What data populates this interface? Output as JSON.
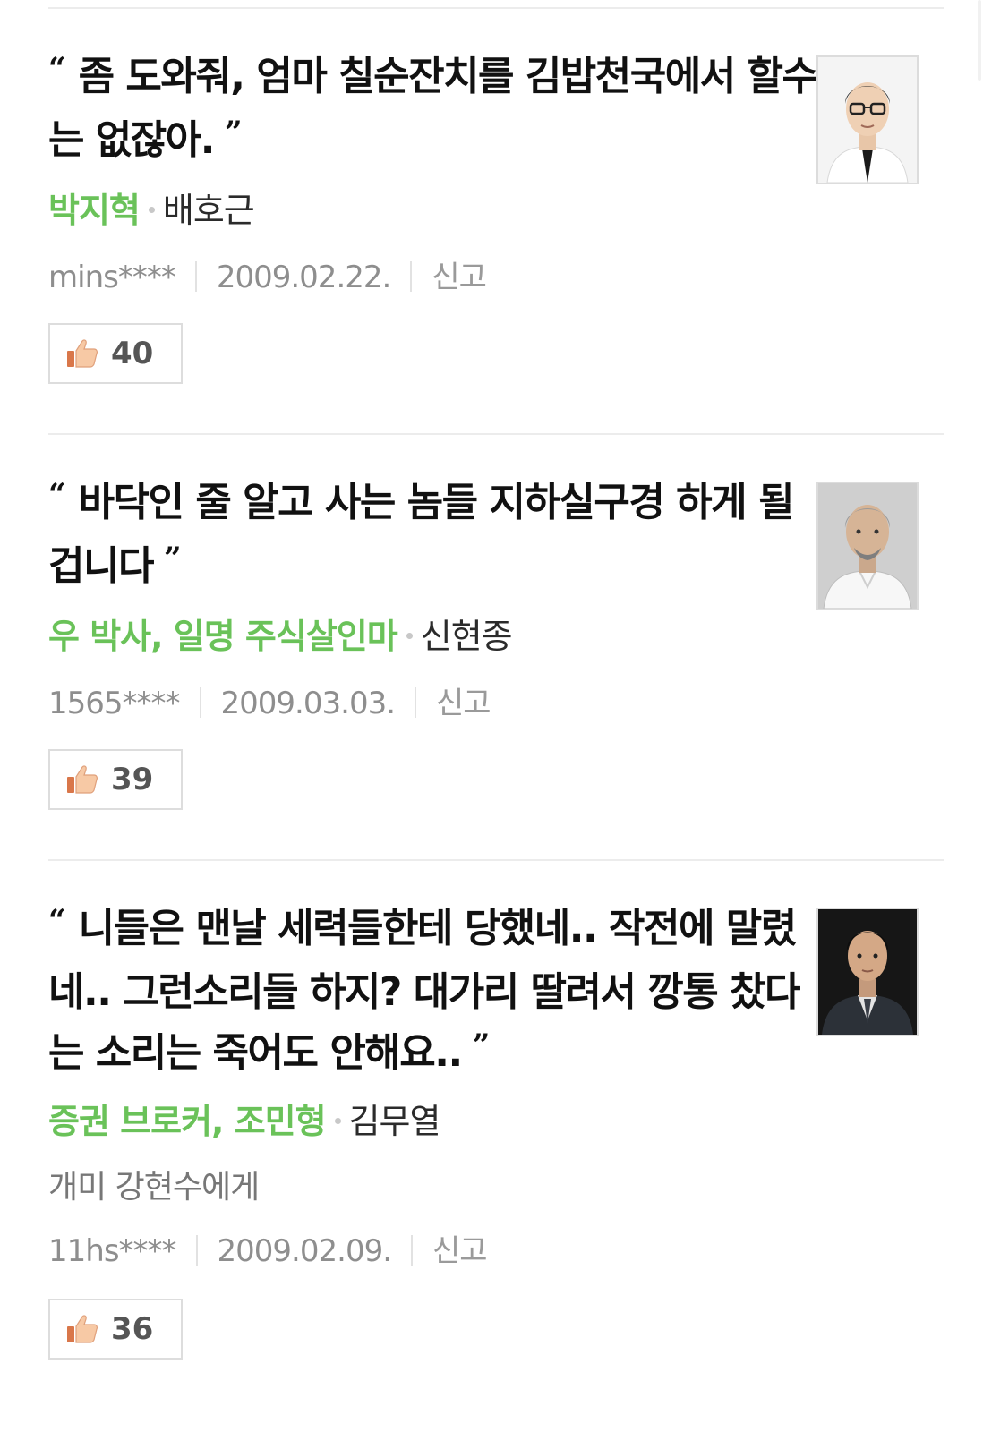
{
  "comments": [
    {
      "quote": "좀 도와줘, 엄마 칠순잔치를 김밥천국에서 할수는 없잖아.",
      "role": "박지혁",
      "actor": "배호근",
      "user": "mins****",
      "date": "2009.02.22.",
      "report_label": "신고",
      "likes": "40",
      "avatar_icon": "actor-portrait-glasses-tie"
    },
    {
      "quote": "바닥인 줄 알고 사는 놈들 지하실구경 하게 될겁니다",
      "role": "우 박사, 일명 주식살인마",
      "actor": "신현종",
      "user": "1565****",
      "date": "2009.03.03.",
      "report_label": "신고",
      "likes": "39",
      "avatar_icon": "actor-portrait-gray-hair"
    },
    {
      "quote": "니들은 맨날 세력들한테 당했네.. 작전에 말렸네.. 그런소리들 하지? 대가리 딸려서 깡통 찼다는 소리는 죽어도 안해요..",
      "role": "증권 브로커, 조민형",
      "actor": "김무열",
      "addressee": "개미 강현수에게",
      "user": "11hs****",
      "date": "2009.02.09.",
      "report_label": "신고",
      "likes": "36",
      "avatar_icon": "actor-portrait-dark-suit"
    }
  ],
  "quote_open": "“",
  "quote_close": "”",
  "colors": {
    "role": "#6ac259",
    "quote_text": "#111111",
    "meta_text": "#8e8e8e",
    "divider": "#ececec"
  }
}
